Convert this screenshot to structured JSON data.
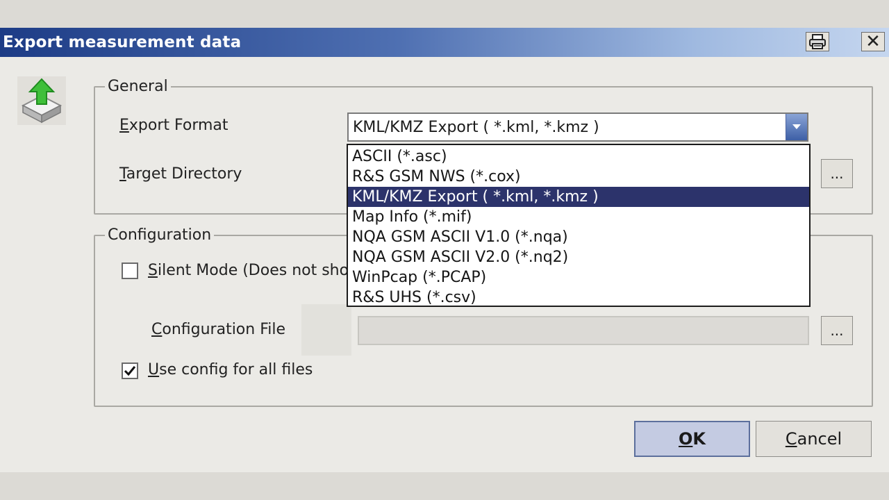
{
  "window": {
    "title": "Export measurement data"
  },
  "general": {
    "legend": "General",
    "export_format_label_u": "E",
    "export_format_label_rest": "xport Format",
    "target_dir_label_u": "T",
    "target_dir_label_rest": "arget Directory",
    "export_format_value": "KML/KMZ Export ( *.kml, *.kmz )",
    "browse_label": "...",
    "dropdown_options": [
      "ASCII (*.asc)",
      "R&S GSM NWS (*.cox)",
      "KML/KMZ Export ( *.kml, *.kmz )",
      "Map Info (*.mif)",
      "NQA GSM ASCII V1.0 (*.nqa)",
      "NQA GSM ASCII V2.0 (*.nq2)",
      "WinPcap (*.PCAP)",
      "R&S UHS (*.csv)"
    ],
    "selected_index": 2
  },
  "configuration": {
    "legend": "Configuration",
    "silent_mode_u": "S",
    "silent_mode_rest": "ilent Mode (Does not show",
    "silent_mode_checked": false,
    "config_file_u": "C",
    "config_file_rest": "onfiguration File",
    "browse_label": "...",
    "use_config_u": "U",
    "use_config_rest": "se config for all files",
    "use_config_checked": true
  },
  "buttons": {
    "ok_u": "O",
    "ok_rest": "K",
    "cancel_u": "C",
    "cancel_rest": "ancel"
  },
  "icons": {
    "export": "export-arrow-icon",
    "print": "printer-icon",
    "close": "close-icon"
  },
  "colors": {
    "title_start": "#1d3c86",
    "title_end": "#c5d6ef",
    "selection": "#2c336b"
  }
}
